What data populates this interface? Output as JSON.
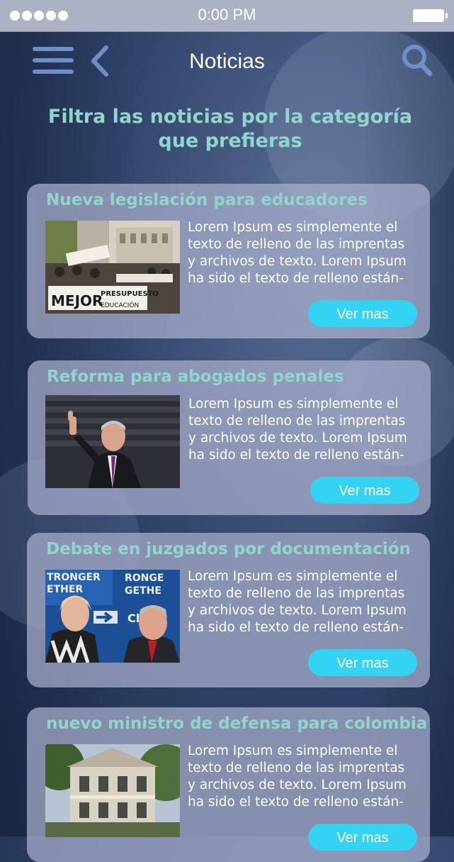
{
  "status_bar": {
    "time": "0:00 PM"
  },
  "nav": {
    "title": "Noticias"
  },
  "filter_heading": "Filtra las noticias por la categoría que prefieras",
  "news": [
    {
      "title": "Nueva legislación para educadores",
      "text": "Lorem Ipsum es simplemente el texto de relleno de las imprentas y archivos de texto. Lorem Ipsum ha sido el texto de relleno están-",
      "button": "Ver mas",
      "image_alt": "protest-march-photo"
    },
    {
      "title": "Reforma para abogados penales",
      "text": "Lorem Ipsum es simplemente el texto de relleno de las imprentas y archivos de texto. Lorem Ipsum ha sido el texto de relleno están-",
      "button": "Ver mas",
      "image_alt": "speaker-pointing-photo"
    },
    {
      "title": "Debate en juzgados por documentación",
      "text": "Lorem Ipsum es simplemente el texto de relleno de las imprentas y archivos de texto. Lorem Ipsum ha sido el texto de relleno están-",
      "button": "Ver mas",
      "image_alt": "two-politicians-photo"
    },
    {
      "title": "nuevo ministro de defensa para colombia",
      "text": "Lorem Ipsum es simplemente el texto de relleno de las imprentas y archivos de texto. Lorem Ipsum ha sido el texto de relleno están-",
      "button": "Ver mas",
      "image_alt": "colonial-building-photo"
    }
  ],
  "colors": {
    "accent": "#35d3f3",
    "heading": "#8fd6cc",
    "icon": "#6d8ec7"
  }
}
